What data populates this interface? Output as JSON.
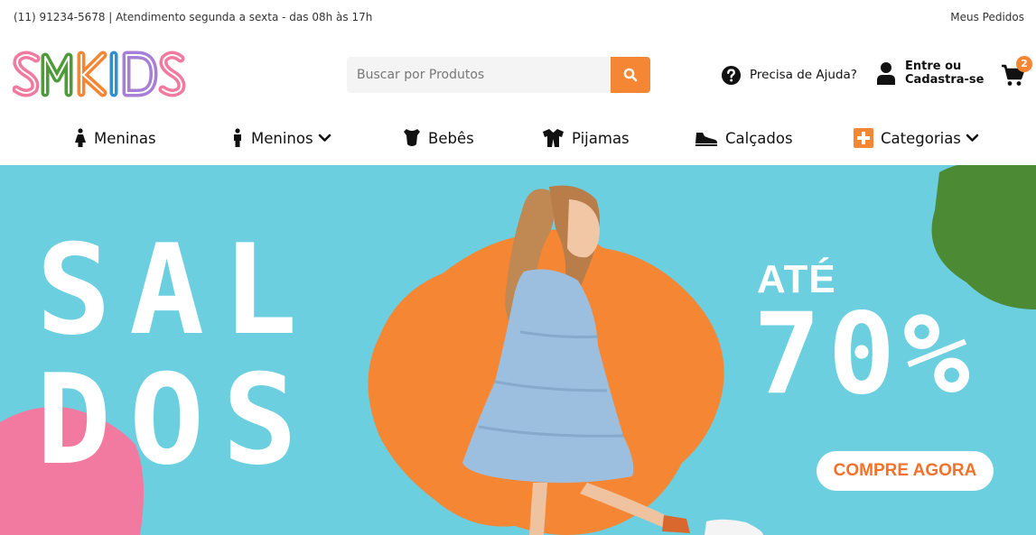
{
  "topbar": {
    "info": "(11) 91234-5678 | Atendimento segunda a sexta - das 08h às 17h",
    "orders": "Meus Pedidos"
  },
  "header": {
    "logo_text": "SMKIDS",
    "search_placeholder": "Buscar por Produtos",
    "help": "Precisa de Ajuda?",
    "account_line1": "Entre ou",
    "account_line2": "Cadastra-se",
    "cart_count": "2"
  },
  "nav": {
    "items": [
      {
        "label": "Meninas",
        "icon": "girl-icon"
      },
      {
        "label": "Meninos",
        "icon": "boy-icon"
      },
      {
        "label": "Bebês",
        "icon": "baby-bodysuit-icon"
      },
      {
        "label": "Pijamas",
        "icon": "pajamas-icon"
      },
      {
        "label": "Calçados",
        "icon": "shoe-icon"
      },
      {
        "label": "Categorias",
        "icon": "plus-square-icon"
      }
    ]
  },
  "banner": {
    "headline_line1": "SAL",
    "headline_line2": "DOS",
    "discount_prefix": "ATÉ",
    "discount_value": "70%",
    "cta": "COMPRE AGORA"
  },
  "colors": {
    "accent": "#f58634",
    "banner_bg": "#6bcfe0",
    "blob_orange": "#f58634",
    "blob_green": "#4c8a33",
    "blob_pink": "#f27aa0"
  }
}
